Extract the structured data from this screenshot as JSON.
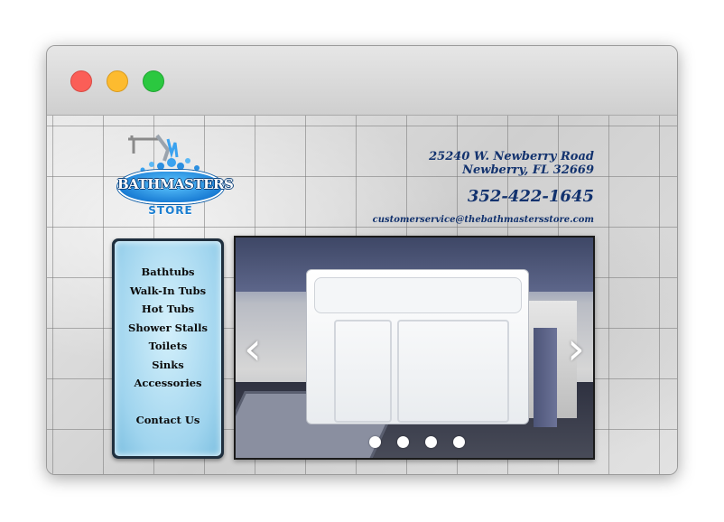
{
  "window": {
    "controls": [
      "close",
      "minimize",
      "zoom"
    ],
    "colors": {
      "close": "#fb5e57",
      "minimize": "#fdbb2f",
      "zoom": "#2bc840"
    }
  },
  "logo": {
    "name": "BATHMASTERS",
    "sub": "STORE",
    "color": "#1c7fd6"
  },
  "contact": {
    "address_line1": "25240 W. Newberry Road",
    "address_line2": "Newberry, FL 32669",
    "phone": "352-422-1645",
    "email": "customerservice@thebathmastersstore.com",
    "color": "#12326e"
  },
  "nav": {
    "items": [
      {
        "label": "Bathtubs"
      },
      {
        "label": "Walk-In Tubs"
      },
      {
        "label": "Hot Tubs"
      },
      {
        "label": "Shower Stalls"
      },
      {
        "label": "Toilets"
      },
      {
        "label": "Sinks"
      },
      {
        "label": "Accessories"
      }
    ],
    "contact_label": "Contact Us"
  },
  "slider": {
    "prev_icon": "chevron-left-icon",
    "next_icon": "chevron-right-icon",
    "slides": 4
  }
}
